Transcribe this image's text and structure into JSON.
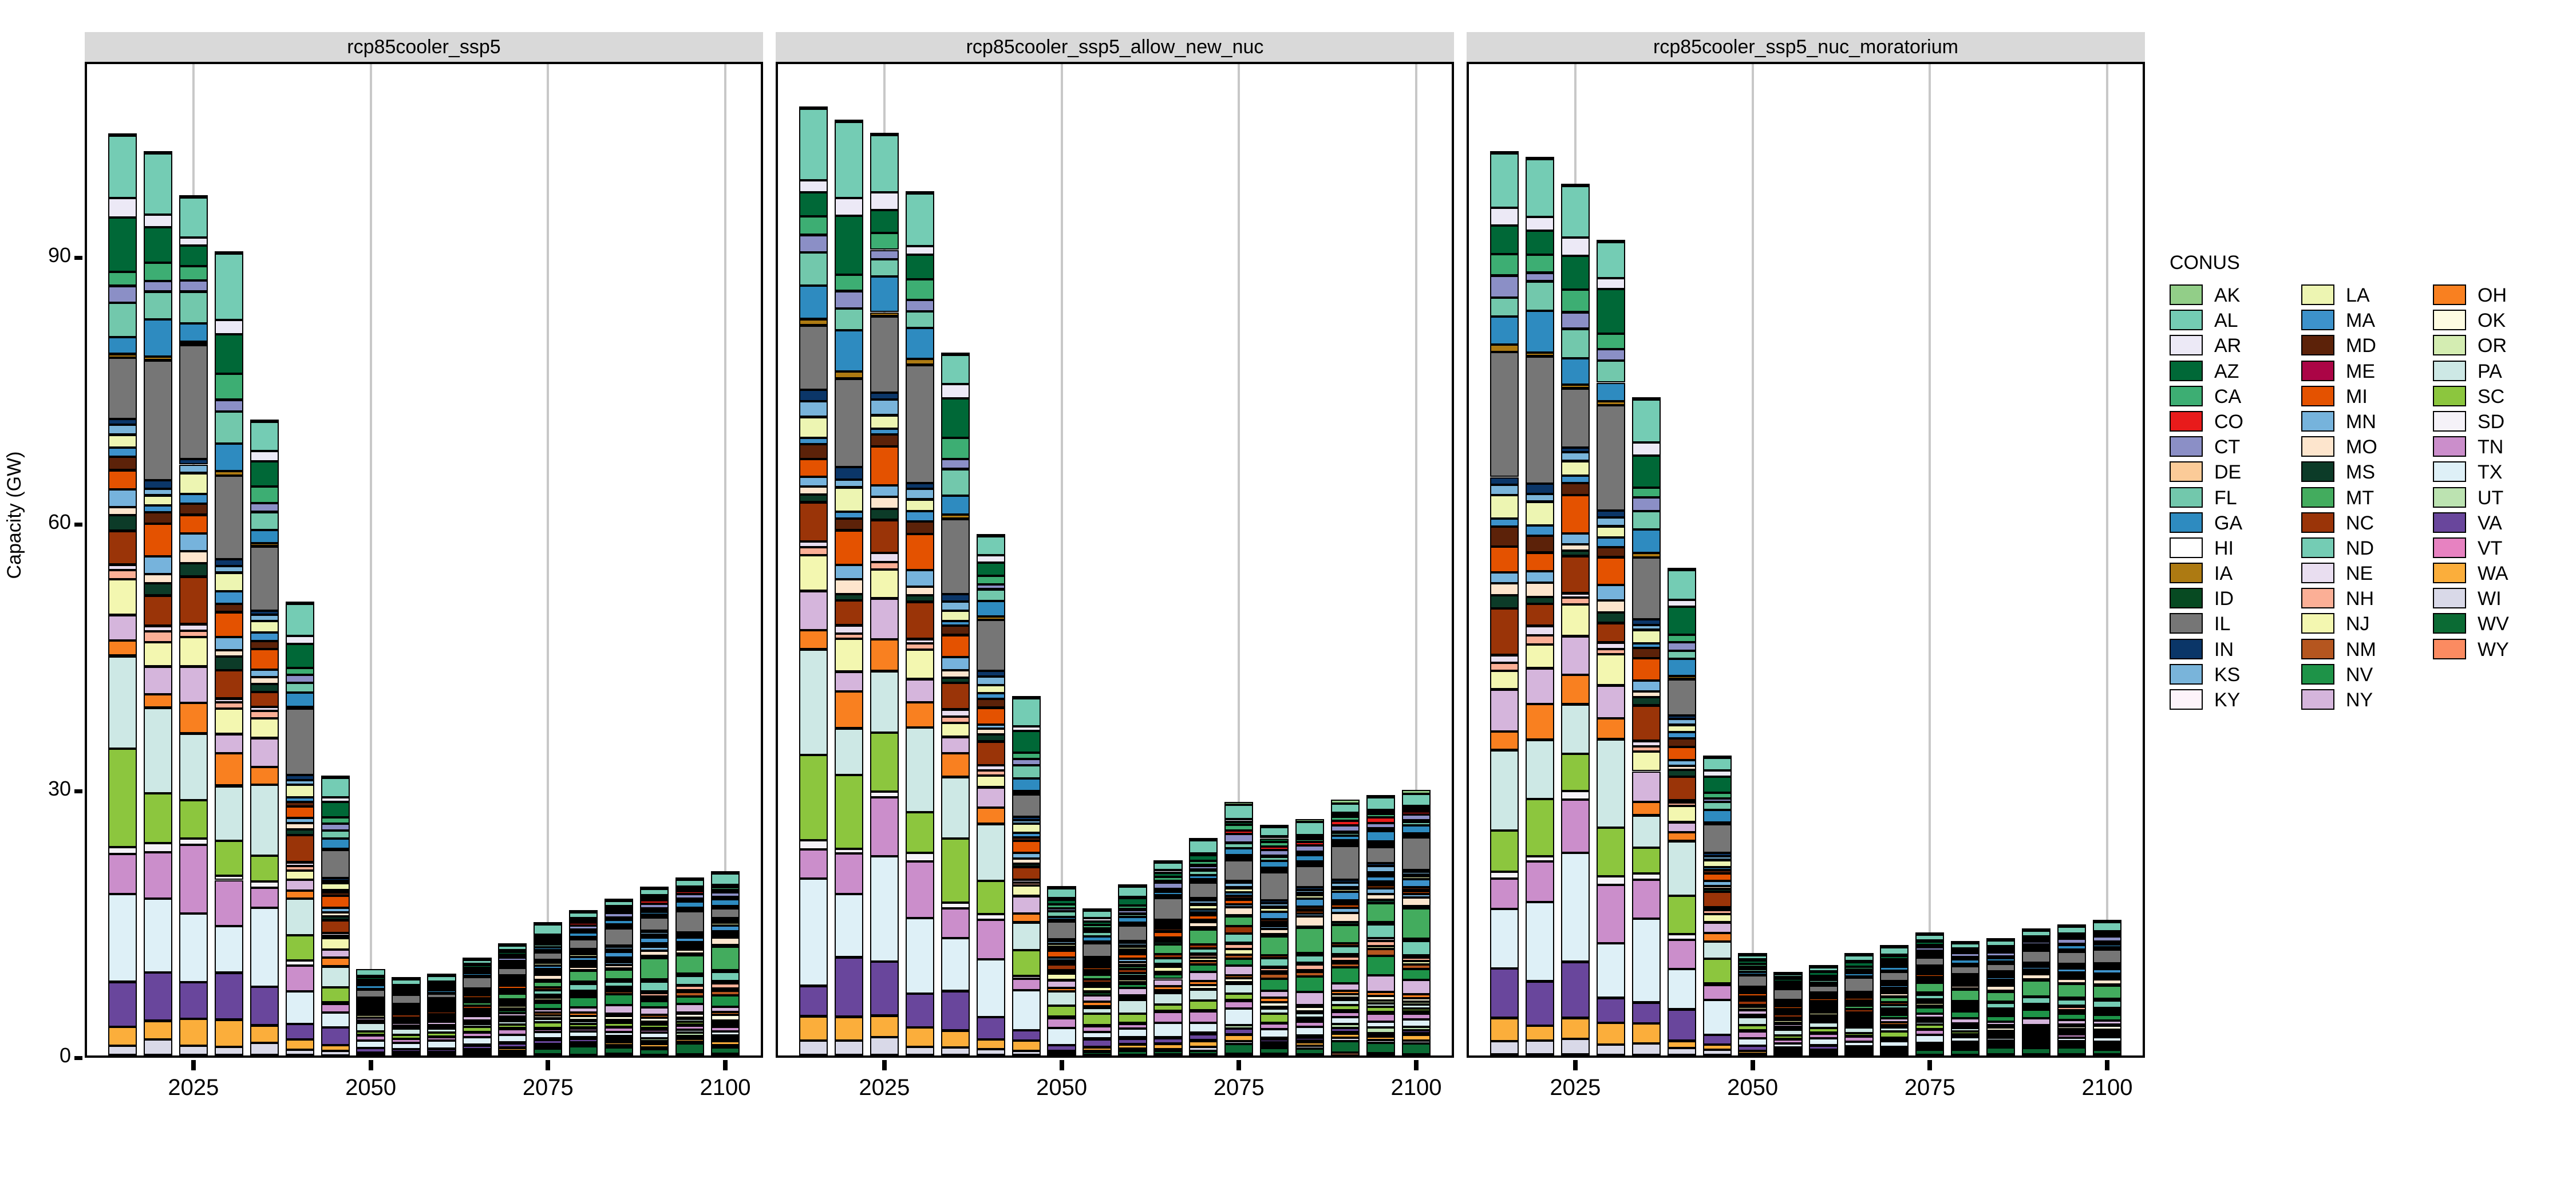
{
  "axes": {
    "ylabel": "Capacity (GW)",
    "yticks": [
      0,
      30,
      60,
      90
    ],
    "ylim": [
      0,
      112
    ],
    "xticks": [
      2025,
      2050,
      2075,
      2100
    ],
    "xlim": [
      2010,
      2105
    ]
  },
  "legend": {
    "title": "CONUS",
    "columns": [
      [
        {
          "label": "AK",
          "color": "#92CE88"
        },
        {
          "label": "AL",
          "color": "#74CCB4"
        },
        {
          "label": "AR",
          "color": "#ECE9F6"
        },
        {
          "label": "AZ",
          "color": "#006837"
        },
        {
          "label": "CA",
          "color": "#3DAE73"
        },
        {
          "label": "CO",
          "color": "#E81B1B"
        },
        {
          "label": "CT",
          "color": "#8B8FC6"
        },
        {
          "label": "DE",
          "color": "#FBCB98"
        },
        {
          "label": "FL",
          "color": "#72C8AC"
        },
        {
          "label": "GA",
          "color": "#2E8BC0"
        },
        {
          "label": "HI",
          "color": "#FFFFFF"
        },
        {
          "label": "IA",
          "color": "#AD7A12"
        },
        {
          "label": "ID",
          "color": "#074A22"
        },
        {
          "label": "IL",
          "color": "#767676"
        },
        {
          "label": "IN",
          "color": "#0B3668"
        },
        {
          "label": "KS",
          "color": "#79B4DA"
        },
        {
          "label": "KY",
          "color": "#FDF3FA"
        }
      ],
      [
        {
          "label": "LA",
          "color": "#EDF5B2"
        },
        {
          "label": "MA",
          "color": "#3D92CB"
        },
        {
          "label": "MD",
          "color": "#5C2209"
        },
        {
          "label": "ME",
          "color": "#AB0546"
        },
        {
          "label": "MI",
          "color": "#E45200"
        },
        {
          "label": "MN",
          "color": "#76B3DC"
        },
        {
          "label": "MO",
          "color": "#FDE5CD"
        },
        {
          "label": "MS",
          "color": "#0C3B28"
        },
        {
          "label": "MT",
          "color": "#43AC5E"
        },
        {
          "label": "NC",
          "color": "#9A3408"
        },
        {
          "label": "ND",
          "color": "#74CCB4"
        },
        {
          "label": "NE",
          "color": "#E9DEF0"
        },
        {
          "label": "NH",
          "color": "#FBAF96"
        },
        {
          "label": "NJ",
          "color": "#F3F7B0"
        },
        {
          "label": "NM",
          "color": "#B5561F"
        },
        {
          "label": "NV",
          "color": "#1E9348"
        },
        {
          "label": "NY",
          "color": "#D5B5DC"
        }
      ],
      [
        {
          "label": "OH",
          "color": "#F98020"
        },
        {
          "label": "OK",
          "color": "#FEFCE2"
        },
        {
          "label": "OR",
          "color": "#D4EDB2"
        },
        {
          "label": "PA",
          "color": "#CDE8E5"
        },
        {
          "label": "SC",
          "color": "#8CC63E"
        },
        {
          "label": "SD",
          "color": "#F5F2F8"
        },
        {
          "label": "TN",
          "color": "#CB8ECB"
        },
        {
          "label": "TX",
          "color": "#DEF0F7"
        },
        {
          "label": "UT",
          "color": "#BCE3B1"
        },
        {
          "label": "VA",
          "color": "#69469C"
        },
        {
          "label": "VT",
          "color": "#E782C1"
        },
        {
          "label": "WA",
          "color": "#FBAE3B"
        },
        {
          "label": "WI",
          "color": "#D9D9E8"
        },
        {
          "label": "WV",
          "color": "#0B6B34"
        },
        {
          "label": "WY",
          "color": "#FB8B61"
        }
      ]
    ]
  },
  "chart_data": {
    "type": "bar",
    "stacked": true,
    "title": "",
    "xlabel": "",
    "ylabel": "Capacity (GW)",
    "ylim": [
      0,
      112
    ],
    "grid": "vertical",
    "legend_position": "right",
    "facet_by": "scenario",
    "x": [
      2015,
      2020,
      2025,
      2030,
      2035,
      2040,
      2045,
      2050,
      2055,
      2060,
      2065,
      2070,
      2075,
      2080,
      2085,
      2090,
      2095,
      2100
    ],
    "state_order": [
      "AK",
      "AL",
      "AR",
      "AZ",
      "CA",
      "CO",
      "CT",
      "DE",
      "FL",
      "GA",
      "HI",
      "IA",
      "ID",
      "IL",
      "IN",
      "KS",
      "KY",
      "LA",
      "MA",
      "MD",
      "ME",
      "MI",
      "MN",
      "MO",
      "MS",
      "MT",
      "NC",
      "ND",
      "NE",
      "NH",
      "NJ",
      "NM",
      "NV",
      "NY",
      "OH",
      "OK",
      "OR",
      "PA",
      "SC",
      "SD",
      "TN",
      "TX",
      "UT",
      "VA",
      "VT",
      "WA",
      "WI",
      "WV",
      "WY"
    ],
    "panels": [
      {
        "title": "rcp85cooler_ssp5",
        "totals": [
          103.5,
          101.5,
          96.5,
          90.2,
          71.3,
          50.8,
          31.2,
          9.7,
          8.6,
          9.0,
          10.8,
          12.5,
          14.9,
          16.2,
          17.6,
          19.0,
          20.0,
          20.7
        ]
      },
      {
        "title": "rcp85cooler_ssp5_allow_new_nuc",
        "totals": [
          106.5,
          105.0,
          103.5,
          97.0,
          78.8,
          58.4,
          40.2,
          18.8,
          16.4,
          19.1,
          21.8,
          24.3,
          28.5,
          25.9,
          26.6,
          28.8,
          29.3,
          29.9
        ]
      },
      {
        "title": "rcp85cooler_ssp5_nuc_moratorium",
        "totals": [
          101.5,
          100.8,
          97.8,
          91.5,
          73.8,
          54.6,
          33.5,
          11.3,
          9.2,
          10.0,
          11.3,
          12.2,
          13.7,
          12.8,
          13.2,
          14.2,
          14.7,
          15.2
        ]
      }
    ]
  }
}
